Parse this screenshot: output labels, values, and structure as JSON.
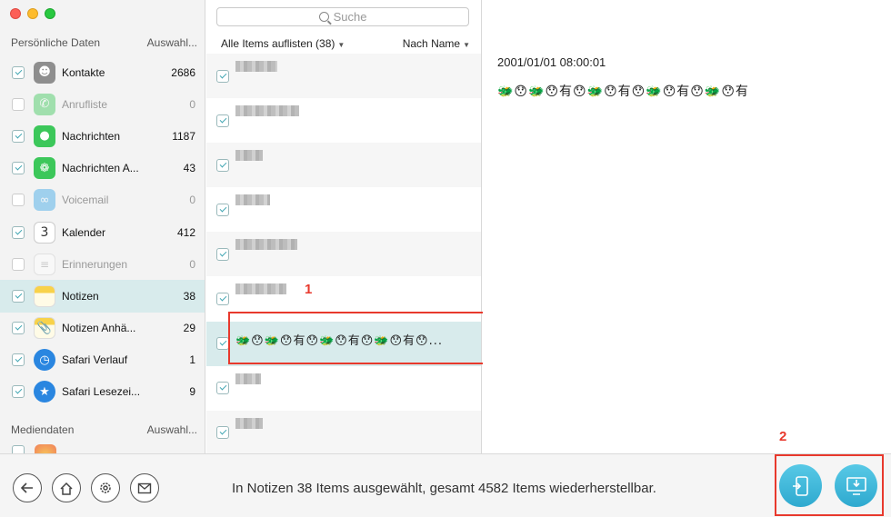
{
  "sidebar": {
    "personal_header": "Persönliche Daten",
    "personal_action": "Auswahl...",
    "media_header": "Mediendaten",
    "media_action": "Auswahl...",
    "items": [
      {
        "label": "Kontakte",
        "count": "2686",
        "checked": true,
        "icon": "contacts-icon",
        "color": "#8a8a8a"
      },
      {
        "label": "Anrufliste",
        "count": "0",
        "checked": false,
        "icon": "phone-icon",
        "color": "#3cc75a"
      },
      {
        "label": "Nachrichten",
        "count": "1187",
        "checked": true,
        "icon": "messages-icon",
        "color": "#3cc75a"
      },
      {
        "label": "Nachrichten A...",
        "count": "43",
        "checked": true,
        "icon": "message-attachments-icon",
        "color": "#3cc75a"
      },
      {
        "label": "Voicemail",
        "count": "0",
        "checked": false,
        "icon": "voicemail-icon",
        "color": "#3aa6e6"
      },
      {
        "label": "Kalender",
        "count": "412",
        "checked": true,
        "icon": "calendar-icon",
        "color": "#ffffff"
      },
      {
        "label": "Erinnerungen",
        "count": "0",
        "checked": false,
        "icon": "reminders-icon",
        "color": "#ffffff"
      },
      {
        "label": "Notizen",
        "count": "38",
        "checked": true,
        "icon": "notes-icon",
        "color": "#f6d64a"
      },
      {
        "label": "Notizen Anhä...",
        "count": "29",
        "checked": true,
        "icon": "notes-attachments-icon",
        "color": "#f6d64a"
      },
      {
        "label": "Safari Verlauf",
        "count": "1",
        "checked": true,
        "icon": "safari-history-icon",
        "color": "#2a86e0"
      },
      {
        "label": "Safari Lesezei...",
        "count": "9",
        "checked": true,
        "icon": "safari-bookmarks-icon",
        "color": "#2a86e0"
      }
    ]
  },
  "list": {
    "search_placeholder": "Suche",
    "list_all": "Alle Items auflisten (38)",
    "sort": "Nach Name",
    "selected_preview": "🐲😯🐲😯有😯🐲😯有😯🐲😯有😯..."
  },
  "detail": {
    "timestamp": "2001/01/01 08:00:01",
    "text": "🐲😯🐲😯有😯🐲😯有😯🐲😯有😯🐲😯有"
  },
  "annotations": {
    "one": "1",
    "two": "2"
  },
  "footer": {
    "status": "In Notizen 38 Items ausgewählt, gesamt 4582 Items wiederherstellbar."
  },
  "colors": {
    "accent": "#3fa5b2",
    "selection": "#d8ebec",
    "annotation": "#e8392d",
    "action_button": "#2ea9cf"
  }
}
